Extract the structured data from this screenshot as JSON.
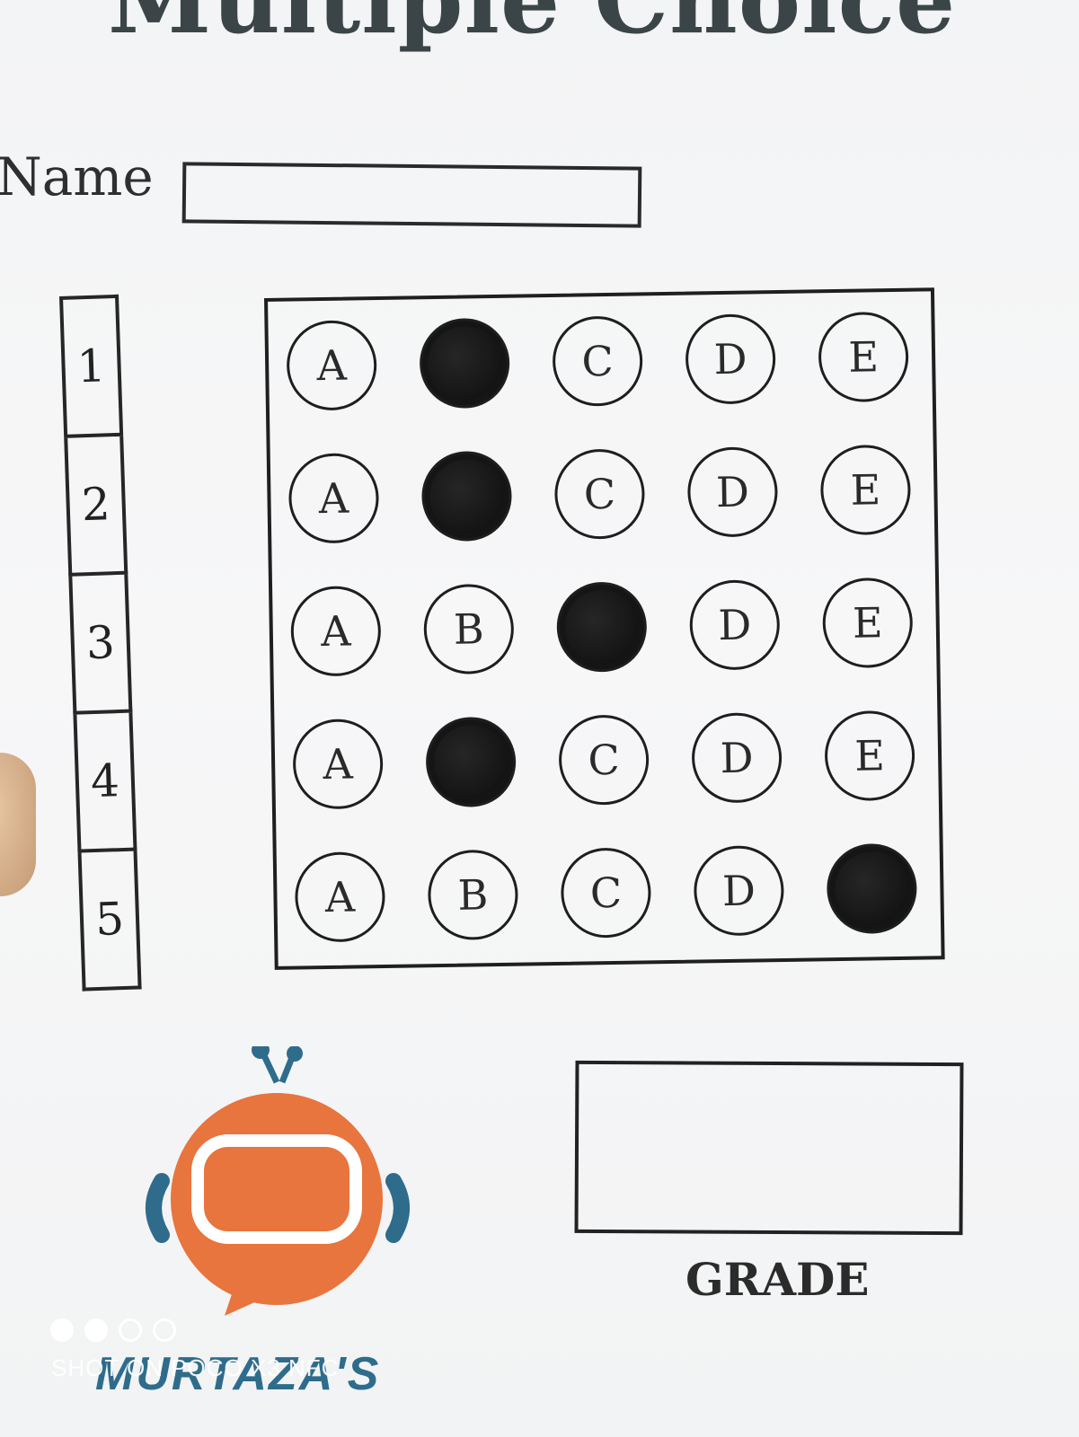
{
  "sheet": {
    "title": "Multiple Choice",
    "name_label": "Name",
    "name_value": "",
    "grade_label": "GRADE",
    "grade_value": "",
    "brand": "MURTAZA'S"
  },
  "questions": [
    {
      "number": "1",
      "selected": "B"
    },
    {
      "number": "2",
      "selected": "B"
    },
    {
      "number": "3",
      "selected": "C"
    },
    {
      "number": "4",
      "selected": "B"
    },
    {
      "number": "5",
      "selected": "E"
    }
  ],
  "options": [
    "A",
    "B",
    "C",
    "D",
    "E"
  ],
  "colors": {
    "ink": "#1e1e1e",
    "title": "#3b4548",
    "logo_orange": "#e8743e",
    "logo_blue": "#2f6c8c",
    "paper": "#f6f6f6"
  },
  "camera_watermark": {
    "text": "SHOT ON POCO X3 NFC",
    "dots": [
      "solid",
      "solid",
      "ring",
      "ring"
    ]
  }
}
